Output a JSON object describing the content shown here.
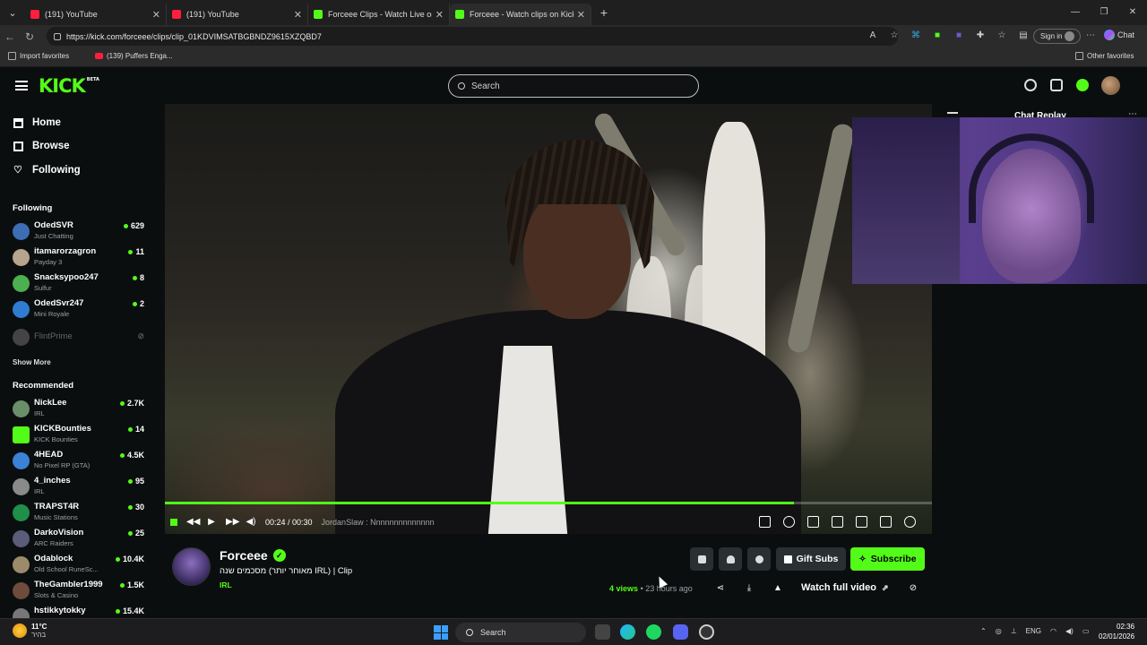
{
  "browser": {
    "tabs": [
      {
        "title": "(191) YouTube",
        "favicon": "youtube-icon",
        "active": false
      },
      {
        "title": "(191) YouTube",
        "favicon": "youtube-icon",
        "active": false
      },
      {
        "title": "Forceee Clips - Watch Live on Kick",
        "favicon": "kick-icon",
        "active": false
      },
      {
        "title": "Forceee - Watch clips on Kick",
        "favicon": "kick-icon",
        "active": true
      }
    ],
    "url": "https://kick.com/forceee/clips/clip_01KDVIMSATBGBNDZ9615XZQBD7",
    "sign_in_label": "Sign in",
    "chat_label": "Chat",
    "favorites": [
      {
        "label": "Import favorites"
      },
      {
        "label": "(139) Puffers Enga..."
      }
    ],
    "other_favorites_label": "Other favorites"
  },
  "kick": {
    "logo_text": "KICK",
    "logo_badge": "BETA",
    "search_placeholder": "Search",
    "accent_color": "#53fc18"
  },
  "sidebar": {
    "nav": [
      {
        "label": "Home",
        "icon": "home-icon"
      },
      {
        "label": "Browse",
        "icon": "browse-icon"
      },
      {
        "label": "Following",
        "icon": "heart-icon"
      }
    ],
    "following_title": "Following",
    "following": [
      {
        "name": "OdedSVR",
        "category": "Just Chatting",
        "viewers": "629"
      },
      {
        "name": "itamarorzagron",
        "category": "Payday 3",
        "viewers": "11"
      },
      {
        "name": "Snacksypoo247",
        "category": "Sulfur",
        "viewers": "8"
      },
      {
        "name": "OdedSvr247",
        "category": "Mini Royale",
        "viewers": "2"
      },
      {
        "name": "FlintPrime",
        "category": "",
        "viewers": ""
      }
    ],
    "show_more_label": "Show More",
    "recommended_title": "Recommended",
    "recommended": [
      {
        "name": "NickLee",
        "category": "IRL",
        "viewers": "2.7K"
      },
      {
        "name": "KICKBounties",
        "category": "KICK Bounties",
        "viewers": "14"
      },
      {
        "name": "4HEAD",
        "category": "No Pixel RP (GTA)",
        "viewers": "4.5K"
      },
      {
        "name": "4_inches",
        "category": "IRL",
        "viewers": "95"
      },
      {
        "name": "TRAPST4R",
        "category": "Music Stations",
        "viewers": "30"
      },
      {
        "name": "DarkoVision",
        "category": "ARC Raiders",
        "viewers": "25"
      },
      {
        "name": "Odablock",
        "category": "Old School RuneSc...",
        "viewers": "10.4K"
      },
      {
        "name": "TheGambler1999",
        "category": "Slots & Casino",
        "viewers": "1.5K"
      },
      {
        "name": "hstikkytokky",
        "category": "",
        "viewers": "15.4K"
      }
    ]
  },
  "player": {
    "time": "00:24 / 00:30",
    "progress_fraction": 0.82,
    "overlay_text": "JordanSlaw : Nnnnnnnnnnnnnn"
  },
  "chat": {
    "title": "Chat Replay"
  },
  "clip": {
    "channel": "Forceee",
    "title": "מאוחר יותר) מסכמים שנה IRL) | Clip",
    "category": "IRL",
    "views_count": "4",
    "views_label": "views",
    "age": "23 hours ago",
    "gift_subs_label": "Gift Subs",
    "subscribe_label": "Subscribe",
    "watch_full_label": "Watch full video"
  },
  "taskbar": {
    "temperature": "11°C",
    "weather_text": "בהיר",
    "search_label": "Search",
    "language": "ENG",
    "time": "02:36",
    "date": "02/01/2026"
  }
}
